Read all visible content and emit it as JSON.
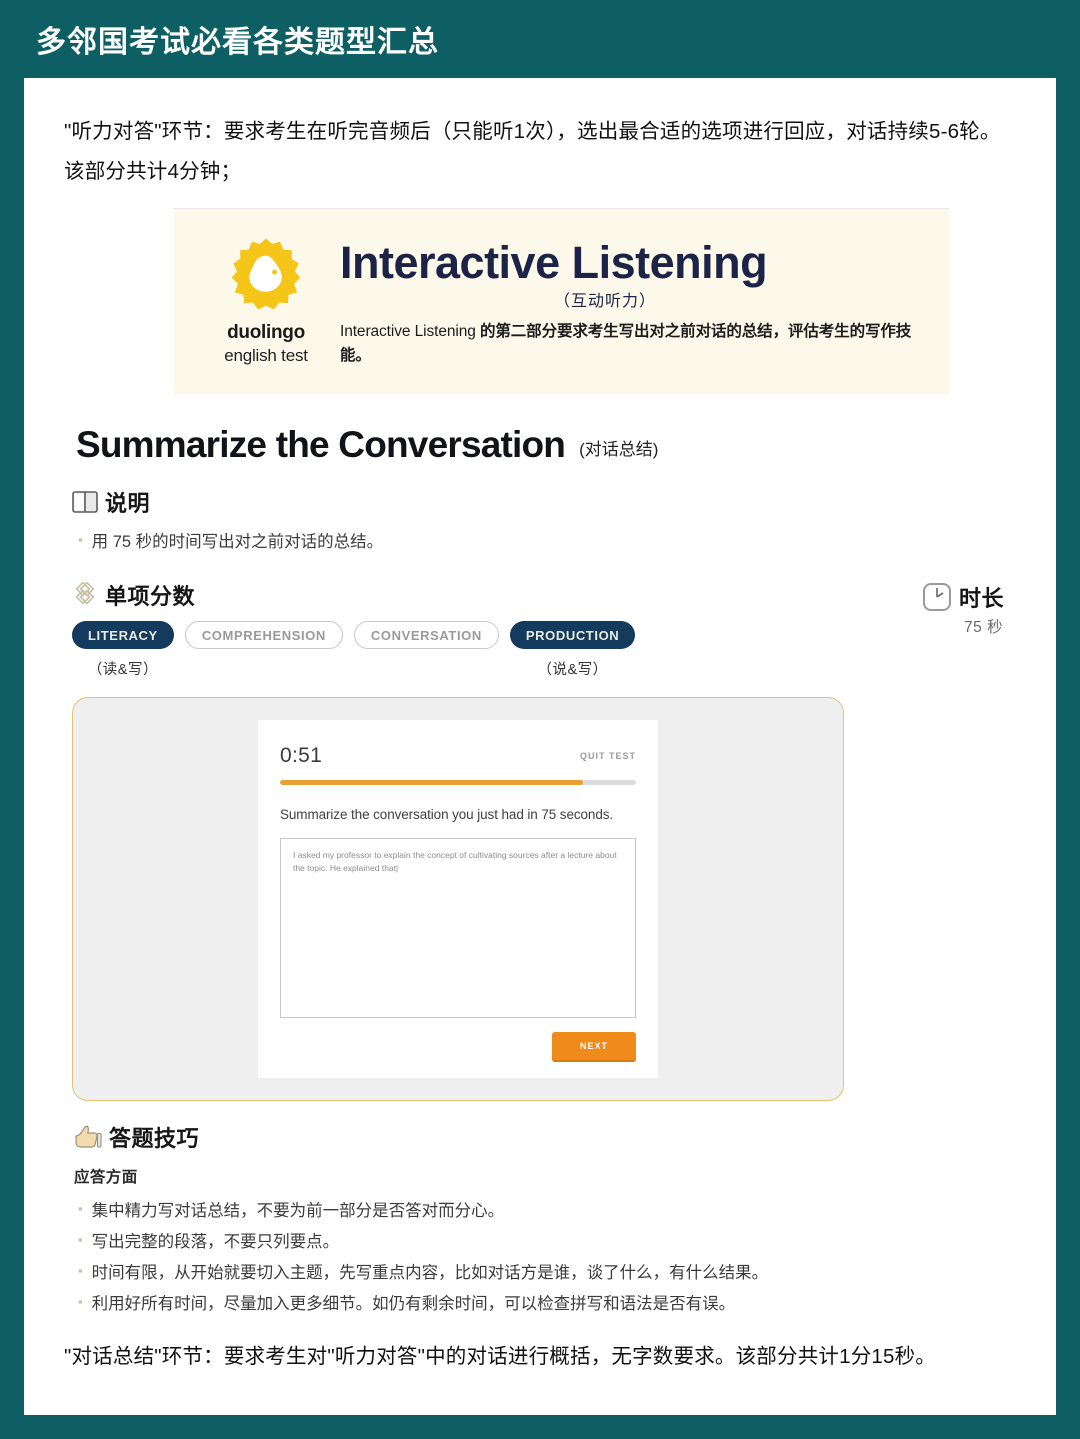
{
  "header": {
    "title": "多邻国考试必看各类题型汇总",
    "bg_color": "#0d5f63"
  },
  "intro_paragraph": "\"听力对答\"环节：要求考生在听完音频后（只能听1次），选出最合适的选项进行回应，对话持续5-6轮。该部分共计4分钟；",
  "banner": {
    "brand_word": "duolingo",
    "brand_sub": "english test",
    "title_en": "Interactive Listening",
    "title_cn": "（互动听力）",
    "description_en": "Interactive Listening",
    "description_cn": " 的第二部分要求考生写出对之前对话的总结，评估考生的写作技能。",
    "bg_color": "#fdf9ea",
    "logo_color": "#f5c519",
    "title_color": "#1b2346"
  },
  "section": {
    "title_en": "Summarize the Conversation",
    "title_cn": "(对话总结)",
    "highlight_color": "#f5dd96"
  },
  "instructions": {
    "icon": "book-icon",
    "heading": "说明",
    "items": [
      "用 75 秒的时间写出对之前对话的总结。"
    ]
  },
  "scores": {
    "icon": "diamond-pattern-icon",
    "heading": "单项分数",
    "tags": [
      {
        "label": "LITERACY",
        "active": true,
        "note": "（读&写）"
      },
      {
        "label": "COMPREHENSION",
        "active": false,
        "note": ""
      },
      {
        "label": "CONVERSATION",
        "active": false,
        "note": ""
      },
      {
        "label": "PRODUCTION",
        "active": true,
        "note": "（说&写）"
      }
    ],
    "active_color": "#143a5e",
    "inactive_color": "#ffffff"
  },
  "duration": {
    "icon": "clock-icon",
    "heading": "时长",
    "value": "75 秒"
  },
  "mockup": {
    "timer": "0:51",
    "quit_label": "QUIT TEST",
    "progress_percent": 85,
    "progress_color": "#e8a033",
    "prompt": "Summarize the conversation you just had in 75 seconds.",
    "answer_text": "I asked my professor to explain the concept of cultivating sources after a lecture about the topic. He explained that|",
    "next_label": "NEXT",
    "next_color": "#ef8a1b",
    "card_border_color": "#e3c46c"
  },
  "tips": {
    "icon": "thumbs-up-icon",
    "heading": "答题技巧",
    "subheading": "应答方面",
    "items": [
      "集中精力写对话总结，不要为前一部分是否答对而分心。",
      "写出完整的段落，不要只列要点。",
      "时间有限，从开始就要切入主题，先写重点内容，比如对话方是谁，谈了什么，有什么结果。",
      "利用好所有时间，尽量加入更多细节。如仍有剩余时间，可以检查拼写和语法是否有误。"
    ]
  },
  "outro_paragraph": "\"对话总结\"环节：要求考生对\"听力对答\"中的对话进行概括，无字数要求。该部分共计1分15秒。"
}
